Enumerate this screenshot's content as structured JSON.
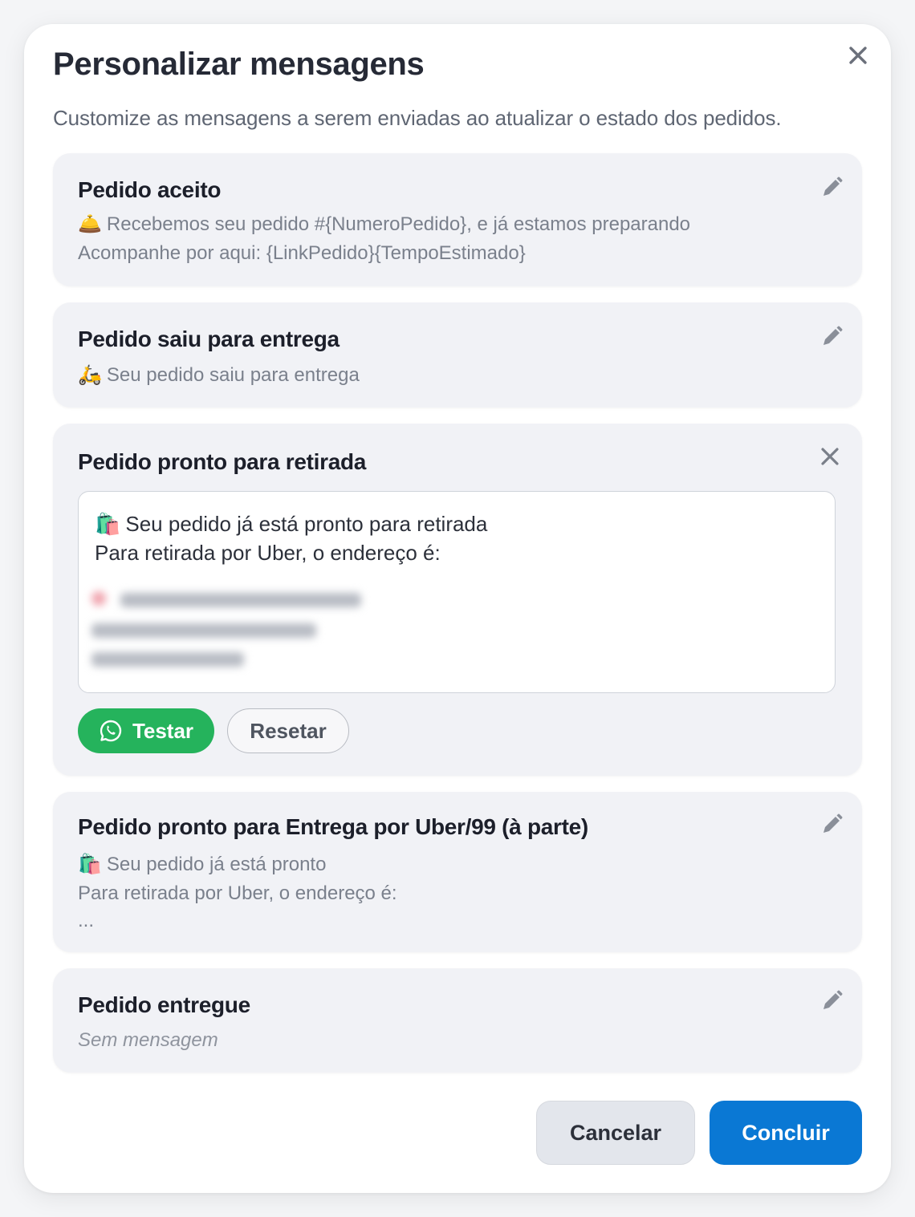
{
  "modal": {
    "title": "Personalizar mensagens",
    "subtitle": "Customize as mensagens a serem enviadas ao atualizar o estado dos pedidos."
  },
  "cards": {
    "accepted": {
      "title": "Pedido aceito",
      "emoji": "🛎️",
      "line1": "Recebemos seu pedido #{NumeroPedido}, e já estamos preparando",
      "line2": "Acompanhe por aqui: {LinkPedido}{TempoEstimado}"
    },
    "out_for_delivery": {
      "title": "Pedido saiu para entrega",
      "emoji": "🛵",
      "line1": "Seu pedido saiu para entrega"
    },
    "ready_pickup": {
      "title": "Pedido pronto para retirada",
      "emoji": "🛍️",
      "text_line1": "Seu pedido já está pronto para retirada",
      "text_line2": "Para retirada por Uber, o endereço é:",
      "test_label": "Testar",
      "reset_label": "Resetar"
    },
    "ready_uber": {
      "title": "Pedido pronto para Entrega por Uber/99 (à parte)",
      "emoji": "🛍️",
      "line1": "Seu pedido já está pronto",
      "line2": "Para retirada por Uber, o endereço é:",
      "line3": "..."
    },
    "delivered": {
      "title": "Pedido entregue",
      "line1": "Sem mensagem"
    }
  },
  "footer": {
    "cancel_label": "Cancelar",
    "done_label": "Concluir"
  },
  "colors": {
    "primary": "#0a78d4",
    "whatsapp": "#25b35c",
    "card_bg": "#f1f2f6"
  }
}
